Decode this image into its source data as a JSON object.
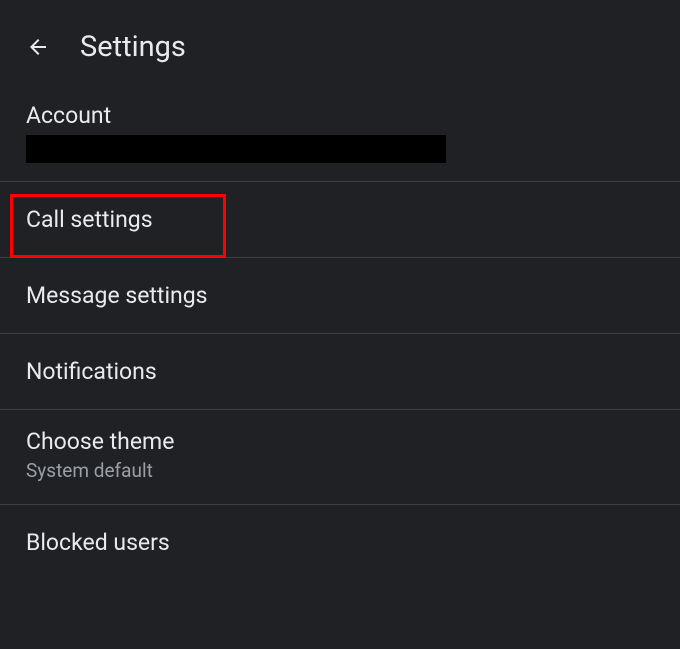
{
  "header": {
    "title": "Settings"
  },
  "account": {
    "label": "Account",
    "value": ""
  },
  "items": {
    "call_settings": "Call settings",
    "message_settings": "Message settings",
    "notifications": "Notifications",
    "choose_theme": "Choose theme",
    "choose_theme_sub": "System default",
    "blocked_users": "Blocked users"
  }
}
